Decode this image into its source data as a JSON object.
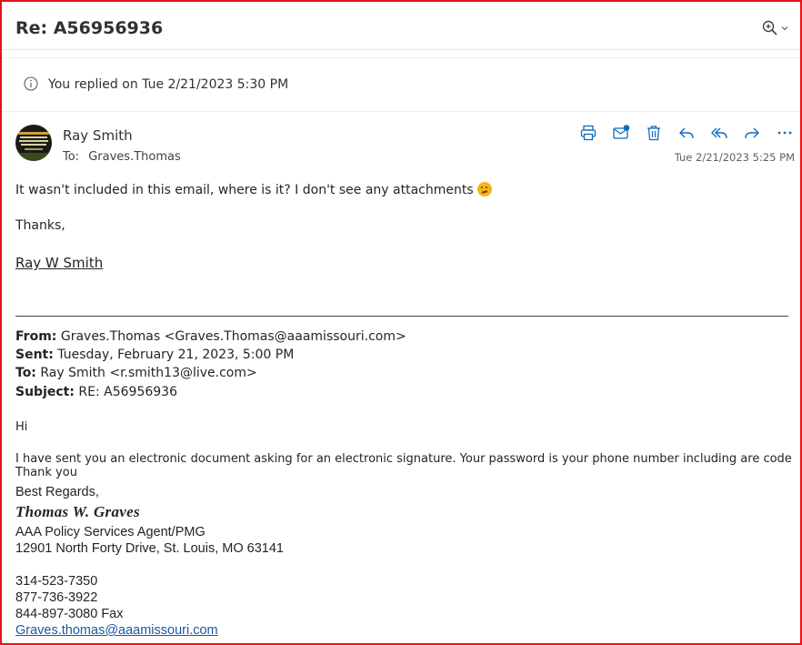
{
  "subject": "Re: A56956936",
  "banner": {
    "text": "You replied on Tue 2/21/2023 5:30 PM"
  },
  "message": {
    "sender": "Ray Smith",
    "to_label": "To:",
    "to": "Graves.Thomas",
    "date": "Tue 2/21/2023 5:25 PM",
    "body_line1": "It wasn't included in this email, where is it? I don't see any attachments",
    "thanks": "Thanks,",
    "signature": "Ray W Smith"
  },
  "toolbar": {
    "icons": [
      "print-icon",
      "mark-unread-icon",
      "delete-icon",
      "reply-icon",
      "reply-all-icon",
      "forward-icon",
      "more-icon"
    ]
  },
  "quoted": {
    "from_label": "From:",
    "from": "Graves.Thomas <Graves.Thomas@aaamissouri.com>",
    "sent_label": "Sent:",
    "sent": "Tuesday, February 21, 2023, 5:00 PM",
    "to_label": "To:",
    "to": "Ray Smith <r.smith13@live.com>",
    "subject_label": "Subject:",
    "subject": "RE: A56956936",
    "greeting": "Hi",
    "body": "I have sent you an electronic document asking for an electronic signature.  Your password is your phone number including are code Thank you",
    "regards": "Best Regards,",
    "sig_name": "Thomas W. Graves",
    "title": "AAA Policy Services Agent/PMG",
    "address": "12901 North Forty Drive, St. Louis, MO 63141",
    "phone1": "314-523-7350",
    "phone2": "877-736-3922",
    "fax": "844-897-3080 Fax",
    "email": "Graves.thomas@aaamissouri.com"
  },
  "colors": {
    "accent": "#0f6cbd",
    "border": "#e8101a"
  }
}
